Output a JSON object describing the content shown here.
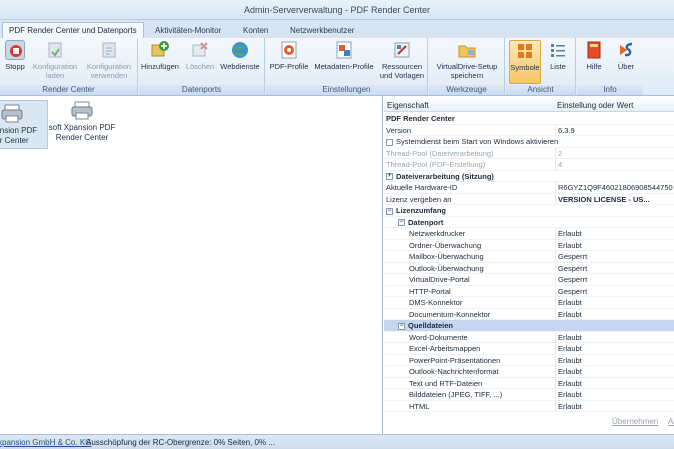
{
  "window": {
    "title": "Admin-Serververwaltung - PDF Render Center"
  },
  "tabs": [
    {
      "label": "PDF Render Center und Datenports"
    },
    {
      "label": "Aktivitäten-Monitor"
    },
    {
      "label": "Konten"
    },
    {
      "label": "Netzwerkbenutzer"
    }
  ],
  "ribbon": {
    "groups": [
      {
        "label": "Render Center",
        "buttons": [
          {
            "label": "Stopp",
            "icon": "stop-icon"
          },
          {
            "label": "Konfiguration\nladen",
            "icon": "load-config-icon"
          },
          {
            "label": "Konfiguration\nverwenden",
            "icon": "use-config-icon"
          }
        ]
      },
      {
        "label": "Datenports",
        "buttons": [
          {
            "label": "Hinzufügen",
            "icon": "add-icon"
          },
          {
            "label": "Löschen",
            "icon": "delete-icon"
          },
          {
            "label": "Webdienste",
            "icon": "globe-icon"
          }
        ]
      },
      {
        "label": "Einstellungen",
        "buttons": [
          {
            "label": "PDF-Profile",
            "icon": "pdf-profile-icon"
          },
          {
            "label": "Metadaten-Profile",
            "icon": "metadata-profile-icon"
          },
          {
            "label": "Ressourcen\nund Vorlagen",
            "icon": "resources-icon"
          }
        ]
      },
      {
        "label": "Werkzeuge",
        "buttons": [
          {
            "label": "VirtualDrive-Setup\nspeichern",
            "icon": "folder-icon"
          }
        ]
      },
      {
        "label": "Ansicht",
        "buttons": [
          {
            "label": "Symbole",
            "icon": "symbols-view-icon"
          },
          {
            "label": "Liste",
            "icon": "list-view-icon"
          }
        ]
      },
      {
        "label": "Info",
        "buttons": [
          {
            "label": "Hilfe",
            "icon": "help-book-icon"
          },
          {
            "label": "Über",
            "icon": "about-logo-icon"
          }
        ]
      }
    ]
  },
  "devices": [
    {
      "label": "xpansion PDF\ner Center"
    },
    {
      "label": "soft Xpansion PDF\nRender Center"
    }
  ],
  "grid": {
    "col_property": "Eigenschaft",
    "col_value": "Einstellung oder Wert",
    "rows": [
      {
        "key": "PDF Render Center",
        "value": ""
      },
      {
        "key": "Version",
        "value": "6.3.9"
      },
      {
        "key": "Systemdienst beim Start von Windows aktivieren",
        "value": ""
      },
      {
        "key": "Thread-Pool (Dateiverarbeitung)",
        "value": "2"
      },
      {
        "key": "Thread-Pool (PDF-Erstellung)",
        "value": "4"
      },
      {
        "key": "Dateiverarbeitung (Sitzung)",
        "value": ""
      },
      {
        "key": "Aktuelle Hardware-ID",
        "value": "R6GYZ1Q9F46021806908544750"
      },
      {
        "key": "Lizenz vergeben an",
        "value": "VERSION LICENSE - US..."
      },
      {
        "key": "Lizenzumfang",
        "value": ""
      },
      {
        "key": "Datenport",
        "value": ""
      },
      {
        "key": "Netzwerkdrucker",
        "value": "Erlaubt"
      },
      {
        "key": "Ordner-Überwachung",
        "value": "Erlaubt"
      },
      {
        "key": "Mailbox-Überwachung",
        "value": "Gesperrt"
      },
      {
        "key": "Outlook-Überwachung",
        "value": "Gesperrt"
      },
      {
        "key": "VirtualDrive-Portal",
        "value": "Gesperrt"
      },
      {
        "key": "HTTP-Portal",
        "value": "Gesperrt"
      },
      {
        "key": "DMS-Konnektor",
        "value": "Erlaubt"
      },
      {
        "key": "Documentum-Konnektor",
        "value": "Erlaubt"
      },
      {
        "key": "Quelldateien",
        "value": ""
      },
      {
        "key": "Word-Dokumente",
        "value": "Erlaubt"
      },
      {
        "key": "Excel-Arbeitsmappen",
        "value": "Erlaubt"
      },
      {
        "key": "PowerPoint-Präsentationen",
        "value": "Erlaubt"
      },
      {
        "key": "Outlook-Nachrichtenformat",
        "value": "Erlaubt"
      },
      {
        "key": "Text und RTF-Dateien",
        "value": "Erlaubt"
      },
      {
        "key": "Bilddateien (JPEG, TIFF, ...)",
        "value": "Erlaubt"
      },
      {
        "key": "HTML",
        "value": "Erlaubt"
      }
    ]
  },
  "actions": {
    "apply": "Übernehmen",
    "cancel": "Ab"
  },
  "status": {
    "company": "xpansion GmbH & Co. KG",
    "usage": "Ausschöpfung der RC-Obergrenze: 0% Seiten, 0% ..."
  }
}
